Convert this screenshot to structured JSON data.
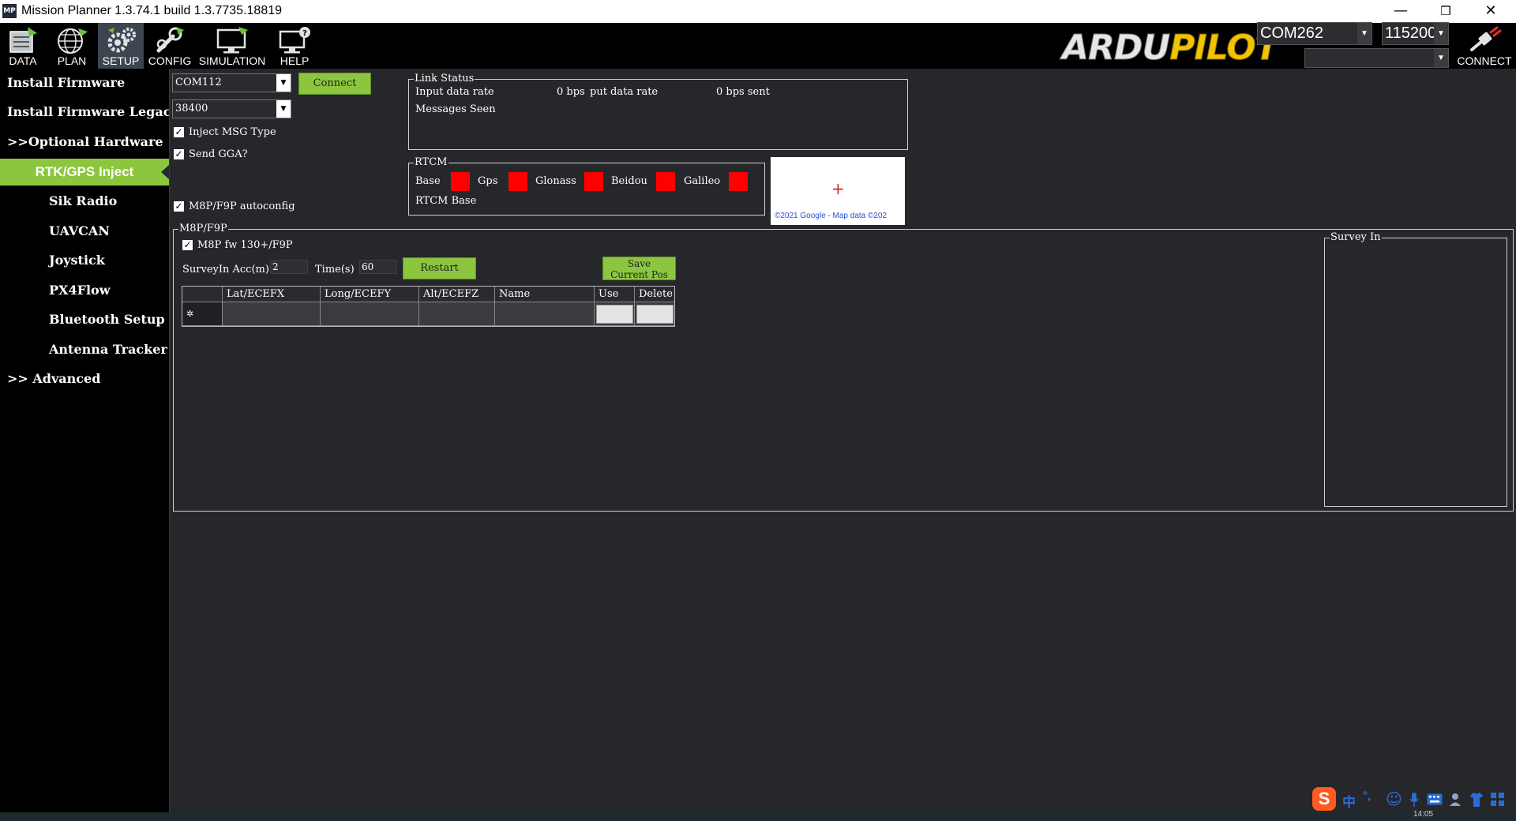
{
  "window": {
    "icon_text": "MP",
    "title": "Mission Planner 1.3.74.1 build 1.3.7735.18819",
    "minimize": "—",
    "restore": "❐",
    "close": "✕"
  },
  "toolbar": {
    "buttons": [
      {
        "label": "DATA",
        "icon": "data-icon"
      },
      {
        "label": "PLAN",
        "icon": "globe-icon"
      },
      {
        "label": "SETUP",
        "icon": "gears-icon"
      },
      {
        "label": "CONFIG",
        "icon": "wrench-icon"
      },
      {
        "label": "SIMULATION",
        "icon": "monitor-icon"
      },
      {
        "label": "HELP",
        "icon": "help-monitor-icon"
      }
    ],
    "active": "SETUP",
    "logo_part1": "ARDU",
    "logo_part2": "PILOT",
    "com_port": "COM262",
    "baud": "115200",
    "connect_label": "CONNECT"
  },
  "sidebar": {
    "items": [
      {
        "label": "Install Firmware"
      },
      {
        "label": "Install Firmware Legacy"
      },
      {
        "label": ">>Optional Hardware"
      },
      {
        "label": "RTK/GPS Inject"
      },
      {
        "label": "Sik Radio"
      },
      {
        "label": "UAVCAN"
      },
      {
        "label": "Joystick"
      },
      {
        "label": "PX4Flow"
      },
      {
        "label": "Bluetooth Setup"
      },
      {
        "label": "Antenna Tracker"
      },
      {
        "label": ">> Advanced"
      }
    ],
    "active_index": 3
  },
  "inject": {
    "port": "COM112",
    "baud": "38400",
    "connect_label": "Connect",
    "inject_msg_type": "Inject MSG Type",
    "send_gga": "Send GGA?",
    "autoconfig": "M8P/F9P autoconfig"
  },
  "link_status": {
    "title": "Link Status",
    "input_label": "Input data rate",
    "input_value": "0 bps",
    "output_label": "put data rate",
    "output_value": "0 bps sent",
    "messages_seen": "Messages Seen"
  },
  "rtcm": {
    "title": "RTCM",
    "labels": [
      "Base",
      "Gps",
      "Glonass",
      "Beidou",
      "Galileo"
    ],
    "status_color": "#ff0000",
    "rtcm_base": "RTCM Base"
  },
  "map": {
    "marker": "+",
    "attribution": "©2021 Google - Map data ©202"
  },
  "m8p": {
    "title": "M8P/F9P",
    "fw_label": "M8P fw 130+/F9P",
    "surveyin_acc_label": "SurveyIn Acc(m)",
    "surveyin_acc_value": "2",
    "time_label": "Time(s)",
    "time_value": "60",
    "restart_label": "Restart",
    "save_pos_label_1": "Save",
    "save_pos_label_2": "Current Pos",
    "columns": [
      "",
      "Lat/ECEFX",
      "Long/ECEFY",
      "Alt/ECEFZ",
      "Name",
      "Use",
      "Delete"
    ],
    "row_marker": "✲"
  },
  "survey_in": {
    "title": "Survey In"
  },
  "tray": {
    "ime": "S",
    "lang": "中",
    "punct": "°,",
    "emoji": "☺",
    "mic": "🎤",
    "keyboard": "⌨",
    "clock": "14:05"
  }
}
